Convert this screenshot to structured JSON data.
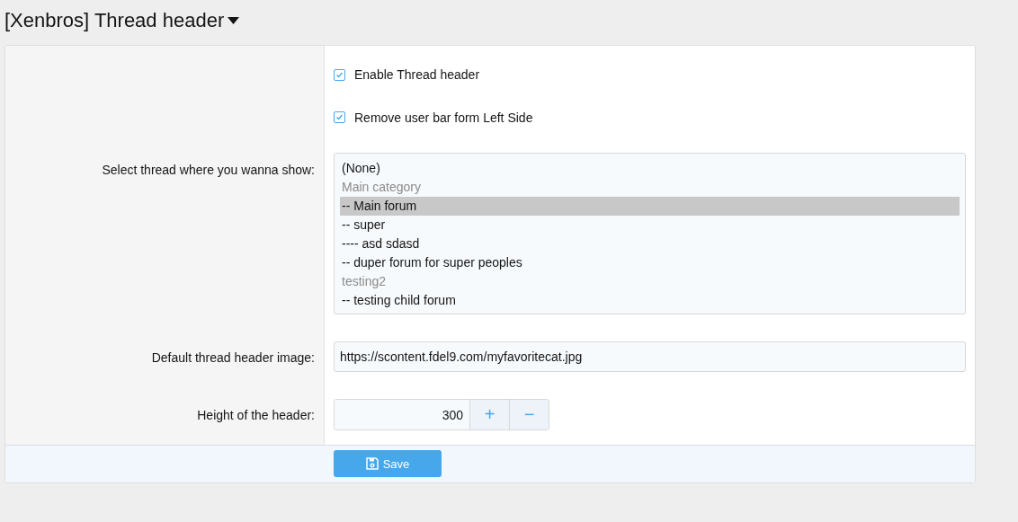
{
  "page_title": "[Xenbros] Thread header",
  "checkboxes": [
    {
      "label": "Enable Thread header",
      "checked": true
    },
    {
      "label": "Remove user bar form Left Side",
      "checked": true
    }
  ],
  "thread_select": {
    "label": "Select thread where you wanna show:",
    "options": [
      {
        "text": "(None)",
        "kind": "option",
        "selected": false
      },
      {
        "text": "Main category",
        "kind": "group",
        "selected": false
      },
      {
        "text": "-- Main forum",
        "kind": "option",
        "selected": true
      },
      {
        "text": "-- super",
        "kind": "option",
        "selected": false
      },
      {
        "text": "---- asd sdasd",
        "kind": "option",
        "selected": false
      },
      {
        "text": "-- duper forum for super peoples",
        "kind": "option",
        "selected": false
      },
      {
        "text": "testing2",
        "kind": "group",
        "selected": false
      },
      {
        "text": "-- testing child forum",
        "kind": "option",
        "selected": false
      }
    ]
  },
  "image_field": {
    "label": "Default thread header image:",
    "value": "https://scontent.fdel9.com/myfavoritecat.jpg"
  },
  "height_field": {
    "label": "Height of the header:",
    "value": "300",
    "increment": "+",
    "decrement": "−"
  },
  "save_button": "Save"
}
